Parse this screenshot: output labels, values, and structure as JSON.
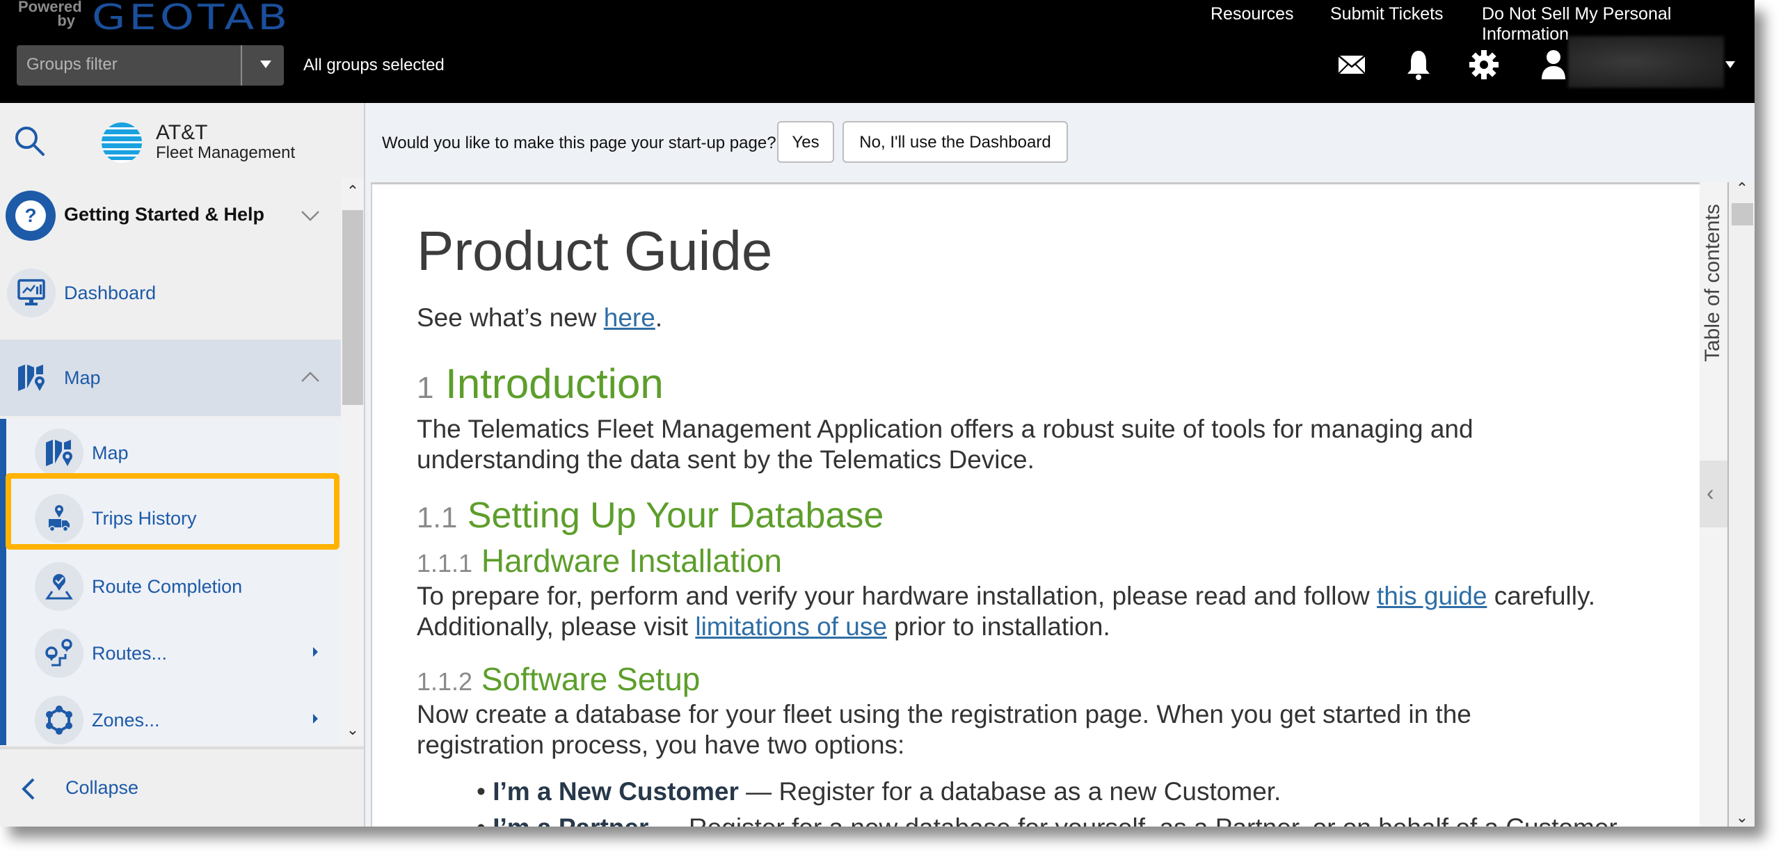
{
  "topbar": {
    "powered_by": "Powered by",
    "brand": "GEOTAB",
    "groups_filter_placeholder": "Groups filter",
    "groups_status": "All groups selected",
    "links": [
      "Resources",
      "Submit Tickets",
      "Do Not Sell My Personal Information"
    ],
    "icons": [
      "mail-icon",
      "bell-icon",
      "gear-icon",
      "user-icon"
    ]
  },
  "sidebar": {
    "logo_line1": "AT&T",
    "logo_line2": "Fleet Management",
    "items": [
      {
        "label": "Getting Started & Help",
        "icon": "help-icon",
        "expand": "chevron-down"
      },
      {
        "label": "Dashboard",
        "icon": "dashboard-icon"
      },
      {
        "label": "Map",
        "icon": "map-icon",
        "expand": "chevron-up",
        "active": true
      }
    ],
    "sub_items": [
      {
        "label": "Map",
        "icon": "map-icon"
      },
      {
        "label": "Trips History",
        "icon": "trips-history-icon",
        "highlighted": true
      },
      {
        "label": "Route Completion",
        "icon": "route-completion-icon"
      },
      {
        "label": "Routes...",
        "icon": "routes-icon",
        "has_submenu": true
      },
      {
        "label": "Zones...",
        "icon": "zones-icon",
        "has_submenu": true
      }
    ],
    "collapse_label": "Collapse"
  },
  "startup_prompt": {
    "question": "Would you like to make this page your start-up page?",
    "yes_label": "Yes",
    "no_label": "No, I'll use the Dashboard"
  },
  "document": {
    "title": "Product Guide",
    "whats_new_prefix": "See what’s new ",
    "whats_new_link": "here",
    "whats_new_suffix": ".",
    "sections": [
      {
        "num": "1",
        "title": "Introduction"
      },
      {
        "num": "1.1",
        "title": "Setting Up Your Database"
      },
      {
        "num": "1.1.1",
        "title": "Hardware Installation"
      },
      {
        "num": "1.1.2",
        "title": "Software Setup"
      }
    ],
    "intro_line1": "The Telematics Fleet Management Application offers a robust suite of tools for managing and",
    "intro_line2": "understanding the data sent by the Telematics Device.",
    "hw_line1_prefix": "To prepare for, perform and verify your hardware installation, please read and follow ",
    "hw_line1_link": "this guide",
    "hw_line1_suffix": " carefully.",
    "hw_line2_prefix": "Additionally, please visit ",
    "hw_line2_link": "limitations of use",
    "hw_line2_suffix": " prior to installation.",
    "sw_line1": "Now create a database for your fleet using the registration page. When you get started in the",
    "sw_line2": "registration process, you have two options:",
    "bullets": [
      {
        "bold": "I’m a New Customer",
        "text": " — Register for a database as a new Customer."
      },
      {
        "bold": "I’m a Partner",
        "text": " — Register for a new database for yourself, as a Partner, or on behalf of a Customer."
      }
    ]
  },
  "toc": {
    "label": "Table of contents"
  }
}
